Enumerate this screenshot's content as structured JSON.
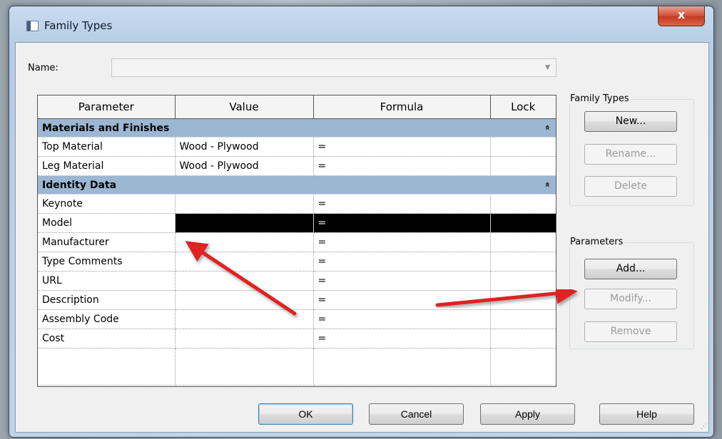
{
  "window": {
    "title": "Family Types",
    "close_label": "x"
  },
  "name_field": {
    "label": "Name:",
    "value": ""
  },
  "grid": {
    "headers": [
      "Parameter",
      "Value",
      "Formula",
      "Lock"
    ],
    "groups": [
      {
        "name": "Materials and Finishes",
        "rows": [
          {
            "parameter": "Top Material",
            "value": "Wood - Plywood",
            "formula": "="
          },
          {
            "parameter": "Leg Material",
            "value": "Wood - Plywood",
            "formula": "="
          }
        ]
      },
      {
        "name": "Identity Data",
        "rows": [
          {
            "parameter": "Keynote",
            "value": "",
            "formula": "="
          },
          {
            "parameter": "Model",
            "value": "",
            "formula": "="
          },
          {
            "parameter": "Manufacturer",
            "value": "",
            "formula": "="
          },
          {
            "parameter": "Type Comments",
            "value": "",
            "formula": "="
          },
          {
            "parameter": "URL",
            "value": "",
            "formula": "="
          },
          {
            "parameter": "Description",
            "value": "",
            "formula": "="
          },
          {
            "parameter": "Assembly Code",
            "value": "",
            "formula": "="
          },
          {
            "parameter": "Cost",
            "value": "",
            "formula": "="
          }
        ]
      }
    ],
    "collapse_glyph": "»"
  },
  "family_types_group": {
    "label": "Family Types",
    "new_label": "New...",
    "rename_label": "Rename...",
    "delete_label": "Delete"
  },
  "parameters_group": {
    "label": "Parameters",
    "add_label": "Add...",
    "modify_label": "Modify...",
    "remove_label": "Remove"
  },
  "footer": {
    "ok_label": "OK",
    "cancel_label": "Cancel",
    "apply_label": "Apply",
    "help_label": "Help"
  },
  "colors": {
    "group_header": "#9cb7d2",
    "selection": "#000000",
    "annotation_arrow": "#e02020"
  }
}
